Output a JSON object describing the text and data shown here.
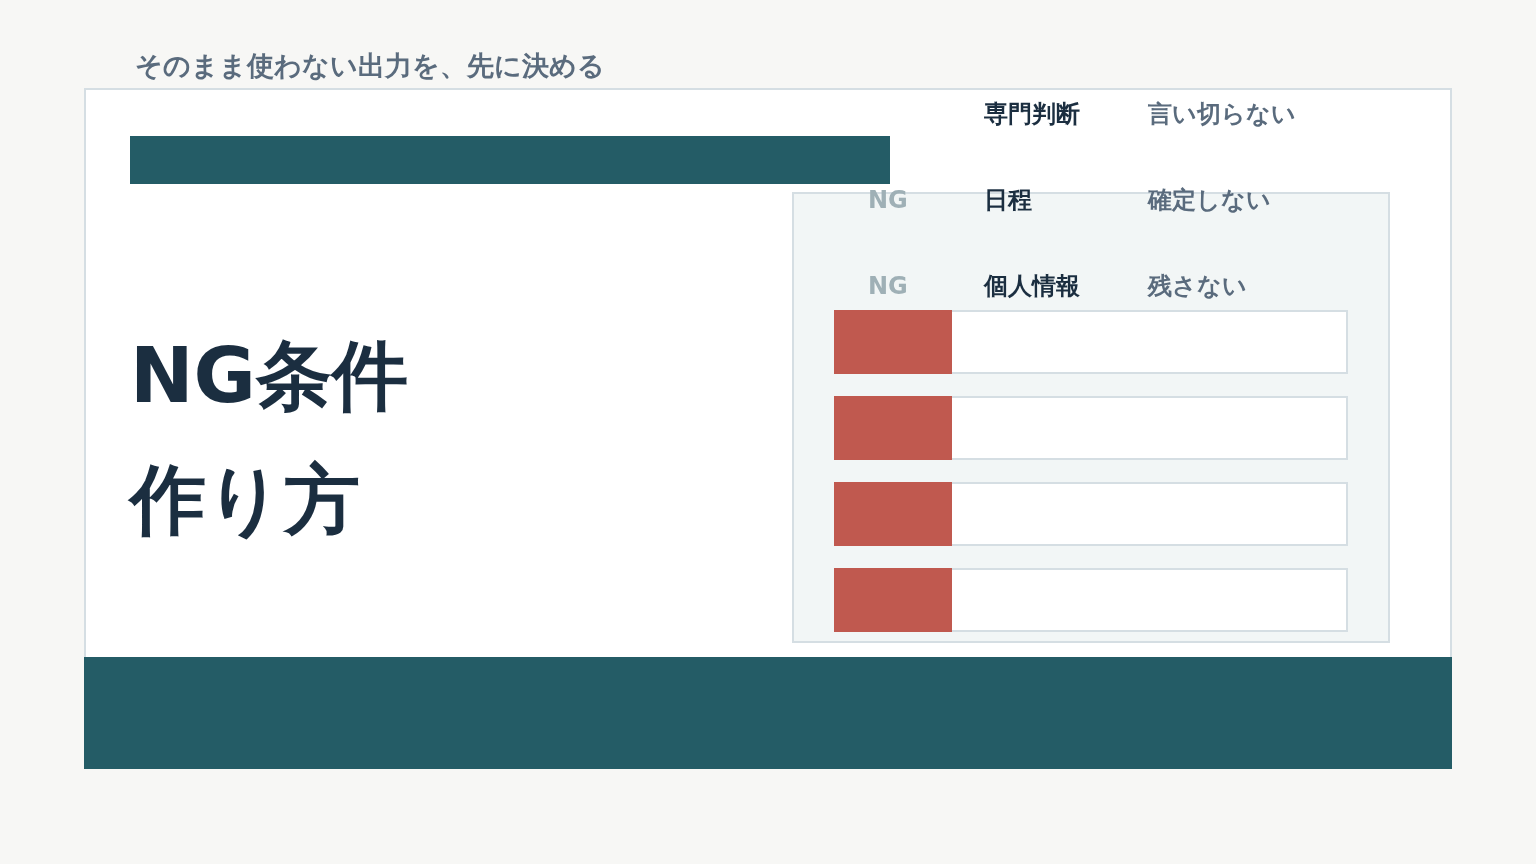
{
  "subtitle": "そのまま使わない出力を、先に決める",
  "title_lines": [
    "NG条件",
    "作り方"
  ],
  "rules": [
    {
      "item": "専門判断",
      "action": "言い切らない"
    },
    {
      "tag": "NG",
      "item": "日程",
      "action": "確定しない"
    },
    {
      "tag": "NG",
      "item": "個人情報",
      "action": "残さない"
    }
  ],
  "card_rows": [
    {
      "kind": "ng-row"
    },
    {
      "kind": "ng-row"
    },
    {
      "kind": "ng-row"
    },
    {
      "kind": "ng-row"
    }
  ]
}
